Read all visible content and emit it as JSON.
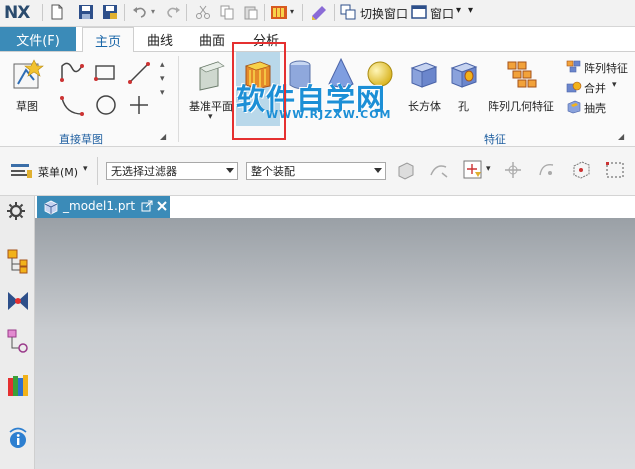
{
  "app": {
    "logo": "NX"
  },
  "qat": {
    "switch_window": "切换窗口",
    "window": "窗口",
    "window_arrow": "▾",
    "more_arrow": "▾"
  },
  "tabs": {
    "file": "文件(F)",
    "home": "主页",
    "curve": "曲线",
    "surface": "曲面",
    "analysis": "分析"
  },
  "ribbon": {
    "sketch": "草图",
    "direct_sketch": "直接草图",
    "datum_plane": "基准平面",
    "block": "长方体",
    "hole": "孔",
    "pattern_geom": "阵列几何特征",
    "pattern_feature": "阵列特征",
    "merge": "合并",
    "shell": "抽壳",
    "feature_group": "特征"
  },
  "cmdbar": {
    "menu": "菜单(M)",
    "filter": "无选择过滤器",
    "assembly": "整个装配"
  },
  "document": {
    "tab_name": "_model1.prt"
  },
  "watermark": {
    "main": "软件自学网",
    "sub": "WWW.RJZXW.COM"
  }
}
